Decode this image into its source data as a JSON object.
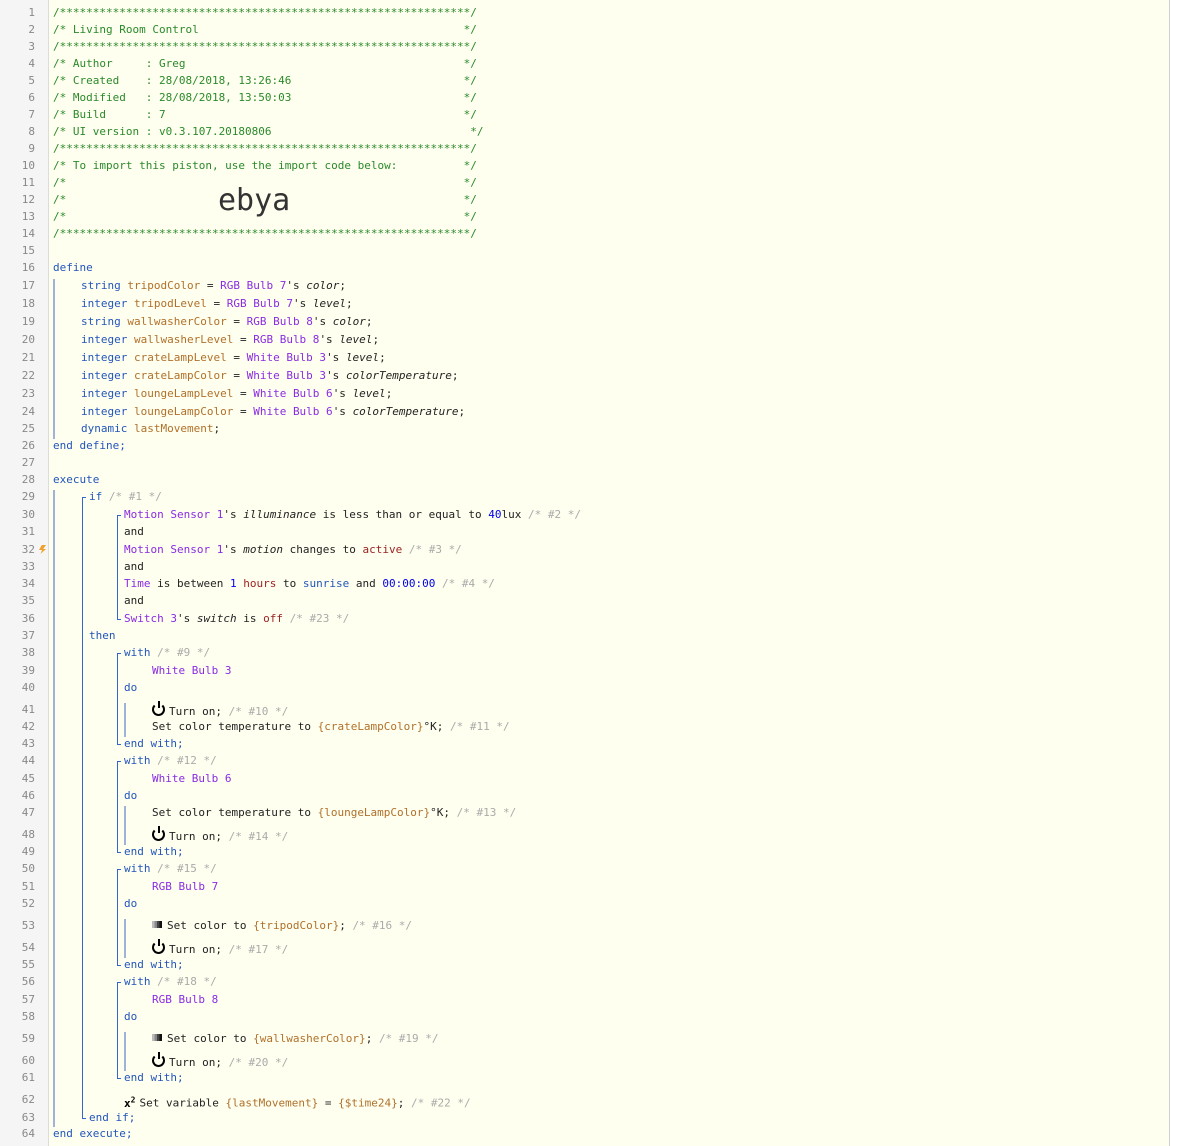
{
  "line_numbers": [
    "1",
    "2",
    "3",
    "4",
    "5",
    "6",
    "7",
    "8",
    "9",
    "10",
    "11",
    "12",
    "13",
    "14",
    "15",
    "16",
    "17",
    "18",
    "19",
    "20",
    "21",
    "22",
    "23",
    "24",
    "25",
    "26",
    "27",
    "28",
    "29",
    "30",
    "31",
    "32",
    "33",
    "34",
    "35",
    "36",
    "37",
    "38",
    "39",
    "40",
    "41",
    "42",
    "43",
    "44",
    "45",
    "46",
    "47",
    "48",
    "49",
    "50",
    "51",
    "52",
    "53",
    "54",
    "55",
    "56",
    "57",
    "58",
    "59",
    "60",
    "61",
    "62",
    "63",
    "64"
  ],
  "header": {
    "border": "/**************************************************************/",
    "title_line": "/* Living Room Control                                        */",
    "author_line": "/* Author     : Greg                                          */",
    "created_line": "/* Created    : 28/08/2018, 13:26:46                          */",
    "modified_line": "/* Modified   : 28/08/2018, 13:50:03                          */",
    "build_line": "/* Build      : 7                                             */",
    "ui_version_line": "/* UI version : v0.3.107.20180806                              */",
    "import_line": "/* To import this piston, use the import code below:          */",
    "blank_line": "/*                                                            */",
    "import_code": "ebya"
  },
  "define": {
    "open": "define",
    "close": "end define;",
    "vars": [
      {
        "type": "string",
        "name": "tripodColor",
        "device": "RGB Bulb 7",
        "attr": "color"
      },
      {
        "type": "integer",
        "name": "tripodLevel",
        "device": "RGB Bulb 7",
        "attr": "level"
      },
      {
        "type": "string",
        "name": "wallwasherColor",
        "device": "RGB Bulb 8",
        "attr": "color"
      },
      {
        "type": "integer",
        "name": "wallwasherLevel",
        "device": "RGB Bulb 8",
        "attr": "level"
      },
      {
        "type": "integer",
        "name": "crateLampLevel",
        "device": "White Bulb 3",
        "attr": "level"
      },
      {
        "type": "integer",
        "name": "crateLampColor",
        "device": "White Bulb 3",
        "attr": "colorTemperature"
      },
      {
        "type": "integer",
        "name": "loungeLampLevel",
        "device": "White Bulb 6",
        "attr": "level"
      },
      {
        "type": "integer",
        "name": "loungeLampColor",
        "device": "White Bulb 6",
        "attr": "colorTemperature"
      }
    ],
    "dynamic_type": "dynamic",
    "dynamic_name": "lastMovement",
    "possessive": "'s ",
    "assign": " = ",
    "semi": ";"
  },
  "execute": {
    "open": "execute",
    "close": "end execute;",
    "if_kw": "if",
    "if_comment": "/* #1 */",
    "then_kw": "then",
    "end_if": "end if;",
    "and_kw": "and",
    "cond1": {
      "device": "Motion Sensor 1",
      "attr": "illuminance",
      "op": "is less than or equal to",
      "value": "40",
      "unit": "lux",
      "comment": "/* #2 */"
    },
    "cond2": {
      "device": "Motion Sensor 1",
      "attr": "motion",
      "op": "changes to",
      "value": "active",
      "comment": "/* #3 */"
    },
    "cond3": {
      "device": "Time",
      "op": "is between",
      "v1": "1",
      "u1": "hours",
      "to": "to",
      "v2": "sunrise",
      "and": "and",
      "v3": "00:00:00",
      "comment": "/* #4 */"
    },
    "cond4": {
      "device": "Switch 3",
      "attr": "switch",
      "op": "is",
      "value": "off",
      "comment": "/* #23 */"
    },
    "with_kw": "with",
    "do_kw": "do",
    "end_with": "end with;",
    "with1": {
      "comment": "/* #9 */",
      "device": "White Bulb 3",
      "a1": "Turn on;",
      "c1": "/* #10 */",
      "a2_pre": "Set color temperature to ",
      "a2_var": "{crateLampColor}",
      "a2_post": "°K;",
      "c2": "/* #11 */"
    },
    "with2": {
      "comment": "/* #12 */",
      "device": "White Bulb 6",
      "a1_pre": "Set color temperature to ",
      "a1_var": "{loungeLampColor}",
      "a1_post": "°K;",
      "c1": "/* #13 */",
      "a2": "Turn on;",
      "c2": "/* #14 */"
    },
    "with3": {
      "comment": "/* #15 */",
      "device": "RGB Bulb 7",
      "a1_pre": "Set color to ",
      "a1_var": "{tripodColor}",
      "a1_post": ";",
      "c1": "/* #16 */",
      "a2": "Turn on;",
      "c2": "/* #17 */"
    },
    "with4": {
      "comment": "/* #18 */",
      "device": "RGB Bulb 8",
      "a1_pre": "Set color to ",
      "a1_var": "{wallwasherColor}",
      "a1_post": ";",
      "c1": "/* #19 */",
      "a2": "Turn on;",
      "c2": "/* #20 */"
    },
    "setvar": {
      "pre": "Set variable ",
      "var": "{lastMovement}",
      "eq": " = ",
      "val": "{$time24}",
      "semi": ";",
      "comment": "/* #22 */"
    }
  },
  "icons": {
    "warning": "lightning-warning-icon",
    "power": "power-icon",
    "color": "color-swatch-icon",
    "variable": "x-squared-icon"
  },
  "colors": {
    "comment": "#2a8a2a",
    "keyword": "#2255bb",
    "device": "#8a2be2",
    "variable": "#b0702a",
    "value": "#9b2222",
    "number": "#0000ee",
    "muted": "#aaaaaa"
  }
}
